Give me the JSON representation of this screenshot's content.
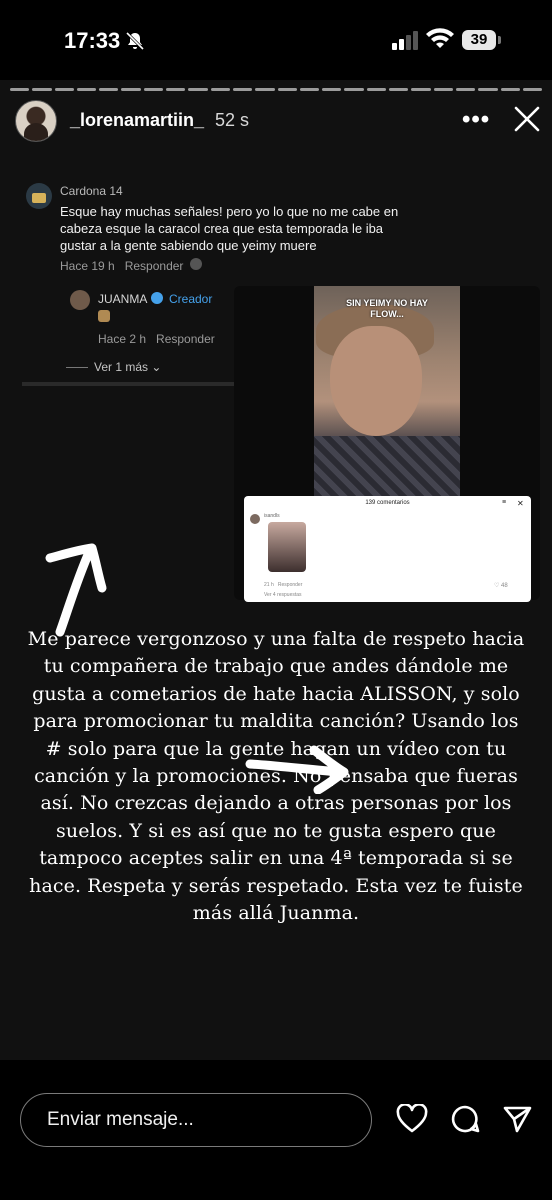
{
  "status_bar": {
    "time": "17:33",
    "battery": "39"
  },
  "story": {
    "username": "_lorenamartiin_",
    "age": "52 s",
    "comment": {
      "user": "Cardona 14",
      "text": "Esque hay muchas señales! pero yo lo que no me cabe en cabeza esque la caracol crea que esta temporada le iba gustar a la gente sabiendo que yeimy muere",
      "time": "Hace 19 h",
      "reply_label": "Responder"
    },
    "reply": {
      "user": "JUANMA",
      "badge": "Creador",
      "time": "Hace 2 h",
      "reply_label": "Responder",
      "more": "Ver 1 más"
    },
    "video": {
      "overlay": "SIN YEIMY NO HAY FLOW...",
      "panel_title": "139 comentarios",
      "panel_user": "isandls",
      "panel_like": "48",
      "panel_time": "21 h",
      "panel_reply": "Responder",
      "panel_more": "Ver 4 respuestas"
    },
    "text": "Me parece vergonzoso y una falta de respeto hacia tu compañera de trabajo que andes dándole me gusta a cometarios de hate hacia ALISSON, y solo para promocionar tu maldita canción? Usando los # solo para que la gente hagan un vídeo con tu canción y la promociones. No pensaba que fueras así. No crezcas dejando a otras personas por los suelos. Y si es así que no te gusta espero que tampoco aceptes salir en una 4ª temporada si se hace. Respeta y serás respetado. Esta vez te fuiste más allá Juanma."
  },
  "footer": {
    "message_placeholder": "Enviar mensaje..."
  }
}
